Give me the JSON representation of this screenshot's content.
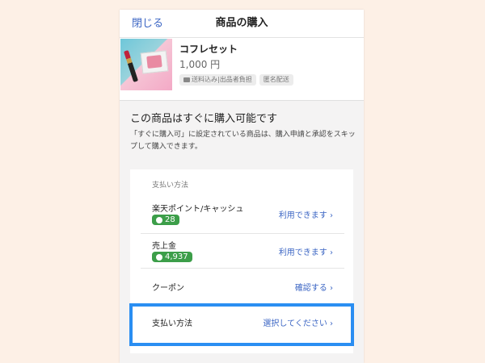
{
  "header": {
    "close_label": "閉じる",
    "title": "商品の購入"
  },
  "product": {
    "name": "コフレセット",
    "price": "1,000 円",
    "tags": [
      "送料込み|出品者負担",
      "匿名配送"
    ]
  },
  "info": {
    "title": "この商品はすぐに購入可能です",
    "description": "「すぐに購入可」に設定されている商品は、購入申請と承認をスキップして購入できます。"
  },
  "payment": {
    "section_label": "支払い方法",
    "rows": [
      {
        "name": "楽天ポイント/キャッシュ",
        "badge": "28",
        "action": "利用できます ›"
      },
      {
        "name": "売上金",
        "badge": "4,937",
        "action": "利用できます ›"
      },
      {
        "name": "クーポン",
        "action": "確認する ›"
      },
      {
        "name": "支払い方法",
        "action": "選択してください ›"
      }
    ]
  },
  "colors": {
    "accent": "#3c66c4",
    "badge": "#3c9e49",
    "highlight": "#2a8ef2",
    "background": "#fdf0e6"
  }
}
